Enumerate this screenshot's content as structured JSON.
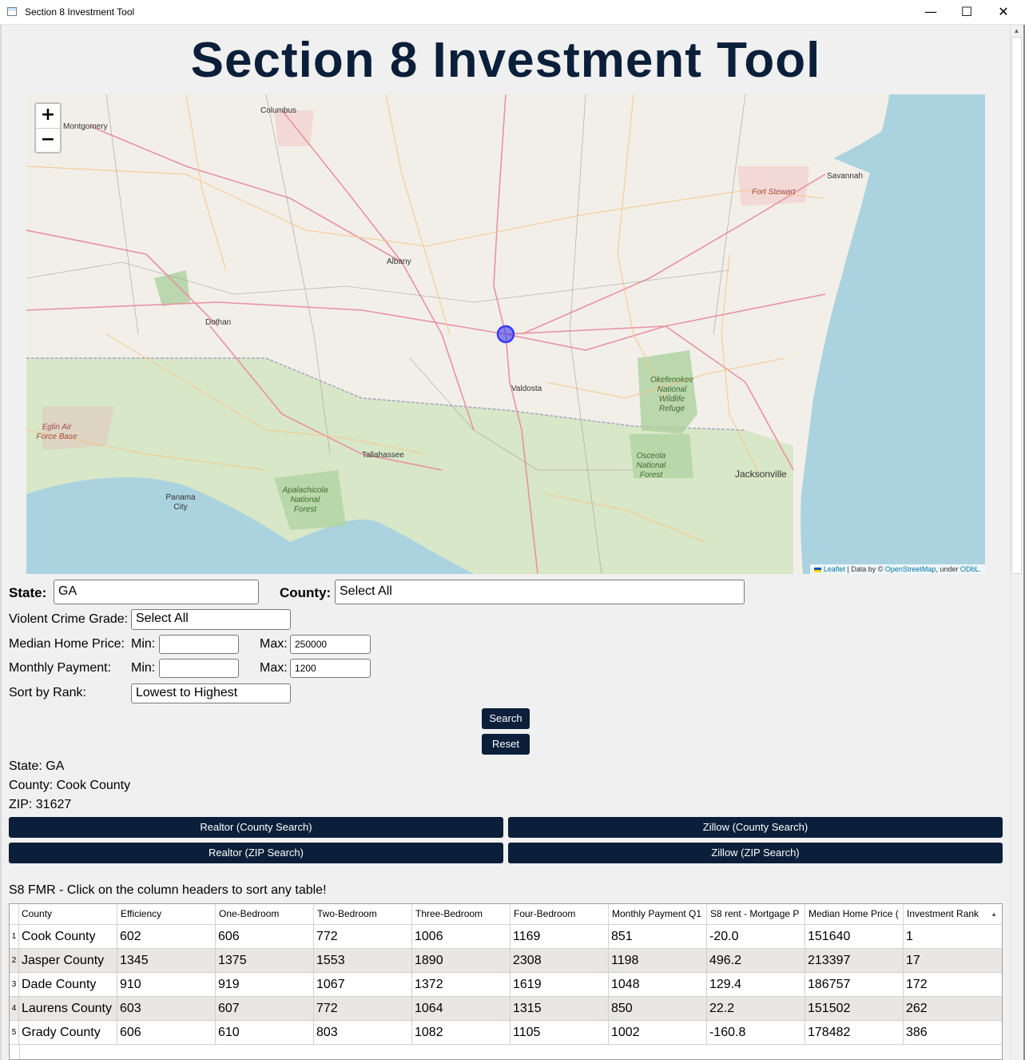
{
  "window": {
    "title": "Section 8 Investment Tool",
    "minimize": "—",
    "maximize": "☐",
    "close": "✕"
  },
  "page": {
    "title": "Section 8 Investment Tool"
  },
  "map": {
    "zoom_in": "+",
    "zoom_out": "−",
    "attribution": {
      "leaflet": "Leaflet",
      "data_by": "| Data by ©",
      "osm": "OpenStreetMap",
      "under": ", under",
      "odbl": "ODbL."
    },
    "labels": {
      "montgomery": "Montgomery",
      "columbus": "Columbus",
      "savannah": "Savannah",
      "fort_stewart": "Fort Stewart",
      "albany": "Albany",
      "dothan": "Dothan",
      "valdosta": "Valdosta",
      "okefenokee": [
        "Okefenokee",
        "National",
        "Wildlife",
        "Refuge"
      ],
      "eglin": [
        "Eglin Air",
        "Force Base"
      ],
      "tallahassee": "Tallahassee",
      "osceola": [
        "Osceola",
        "National",
        "Forest"
      ],
      "jacksonville": "Jacksonville",
      "panama_city": [
        "Panama",
        "City"
      ],
      "apalachicola": [
        "Apalachicola",
        "National",
        "Forest"
      ]
    }
  },
  "form": {
    "state_label": "State:",
    "state_value": "GA",
    "county_label": "County:",
    "county_value": "Select All",
    "crime_label": "Violent Crime Grade:",
    "crime_value": "Select All",
    "price_label": "Median Home Price:",
    "price_min_label": "Min:",
    "price_min_value": "",
    "price_max_label": "Max:",
    "price_max_value": "250000",
    "payment_label": "Monthly Payment:",
    "payment_min_label": "Min:",
    "payment_min_value": "",
    "payment_max_label": "Max:",
    "payment_max_value": "1200",
    "sort_label": "Sort by Rank:",
    "sort_value": "Lowest to Highest",
    "search_button": "Search",
    "reset_button": "Reset"
  },
  "selection": {
    "state": "State: GA",
    "county": "County: Cook County",
    "zip": "ZIP: 31627"
  },
  "links": {
    "realtor_county": "Realtor (County Search)",
    "zillow_county": "Zillow (County Search)",
    "realtor_zip": "Realtor (ZIP Search)",
    "zillow_zip": "Zillow (ZIP Search)"
  },
  "table": {
    "caption": "S8 FMR - Click on the column headers to sort any table!",
    "sort_indicator": "▲",
    "columns": [
      "County",
      "Efficiency",
      "One-Bedroom",
      "Two-Bedroom",
      "Three-Bedroom",
      "Four-Bedroom",
      "Monthly Payment Q1",
      "S8 rent - Mortgage P",
      "Median Home Price (",
      "Investment Rank"
    ],
    "rows": [
      {
        "num": "1",
        "cells": [
          "Cook County",
          "602",
          "606",
          "772",
          "1006",
          "1169",
          "851",
          "-20.0",
          "151640",
          "1"
        ]
      },
      {
        "num": "2",
        "cells": [
          "Jasper County",
          "1345",
          "1375",
          "1553",
          "1890",
          "2308",
          "1198",
          "496.2",
          "213397",
          "17"
        ]
      },
      {
        "num": "3",
        "cells": [
          "Dade County",
          "910",
          "919",
          "1067",
          "1372",
          "1619",
          "1048",
          "129.4",
          "186757",
          "172"
        ]
      },
      {
        "num": "4",
        "cells": [
          "Laurens County",
          "603",
          "607",
          "772",
          "1064",
          "1315",
          "850",
          "22.2",
          "151502",
          "262"
        ]
      },
      {
        "num": "5",
        "cells": [
          "Grady County",
          "606",
          "610",
          "803",
          "1082",
          "1105",
          "1002",
          "-160.8",
          "178482",
          "386"
        ]
      }
    ]
  },
  "colors": {
    "navy": "#0b1f3a",
    "water": "#aad3df",
    "forest": "#add19e",
    "marker": "#3b3bf5"
  }
}
